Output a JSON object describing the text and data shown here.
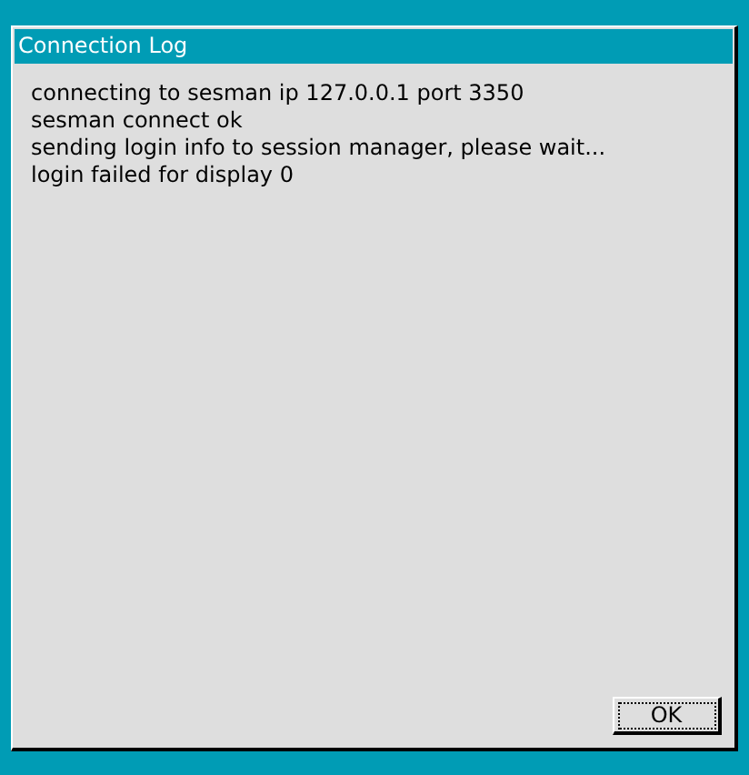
{
  "window": {
    "title": "Connection Log"
  },
  "log_lines": [
    "connecting to sesman ip 127.0.0.1 port 3350",
    "sesman connect ok",
    "sending login info to session manager, please wait...",
    "login failed for display 0"
  ],
  "buttons": [
    {
      "label": "OK",
      "focused": true
    }
  ]
}
